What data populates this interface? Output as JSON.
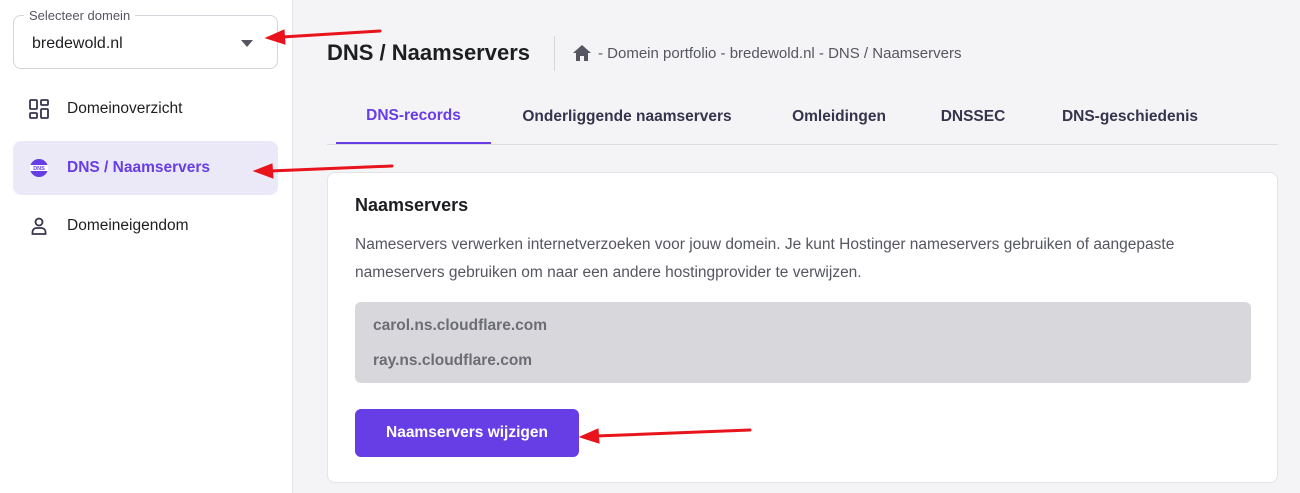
{
  "sidebar": {
    "domain_select": {
      "legend": "Selecteer domein",
      "value": "bredewold.nl"
    },
    "items": [
      {
        "label": "Domeinoverzicht",
        "icon": "dashboard-icon",
        "active": false
      },
      {
        "label": "DNS / Naamservers",
        "icon": "dns-icon",
        "icon_text": "DNS",
        "active": true
      },
      {
        "label": "Domeineigendom",
        "icon": "user-icon",
        "active": false
      }
    ]
  },
  "header": {
    "title": "DNS / Naamservers",
    "breadcrumb": "- Domein portfolio - bredewold.nl - DNS / Naamservers"
  },
  "tabs": [
    {
      "label": "DNS-records",
      "active": true
    },
    {
      "label": "Onderliggende naamservers",
      "active": false
    },
    {
      "label": "Omleidingen",
      "active": false
    },
    {
      "label": "DNSSEC",
      "active": false
    },
    {
      "label": "DNS-geschiedenis",
      "active": false
    }
  ],
  "card": {
    "title": "Naamservers",
    "description": "Nameservers verwerken internetverzoeken voor jouw domein. Je kunt Hostinger nameservers gebruiken of aangepaste nameservers gebruiken om naar een andere hostingprovider te verwijzen.",
    "nameservers": [
      "carol.ns.cloudflare.com",
      "ray.ns.cloudflare.com"
    ],
    "button_label": "Naamservers wijzigen"
  },
  "colors": {
    "accent": "#673de6",
    "annotation_arrow": "#e8131b"
  }
}
